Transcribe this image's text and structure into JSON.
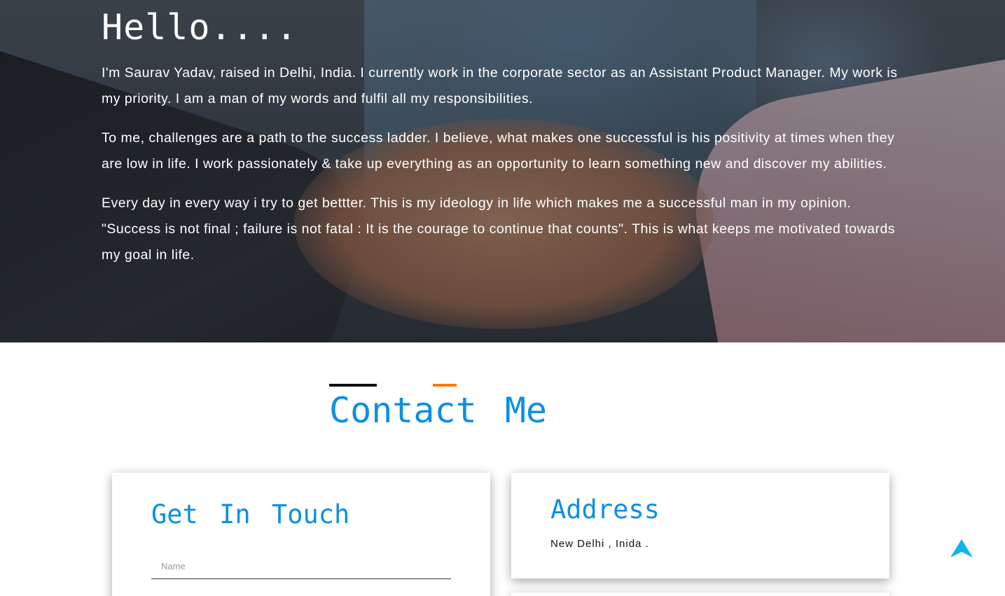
{
  "hero": {
    "greeting": "Hello....",
    "paragraphs": [
      "I'm Saurav Yadav, raised in Delhi, India. I currently work in the corporate sector as an Assistant Product Manager. My work is my priority. I am a man of my words and fulfil all my responsibilities.",
      "To me, challenges are a path to the success ladder. I believe, what makes one successful is his positivity at times when they are low in life. I work passionately & take up everything as an opportunity to learn something new and discover my abilities.",
      "Every day in every way i try to get bettter. This is my ideology in life which makes me a successful man in my opinion. \"Success is not final ; failure is not fatal : It is the courage to continue that counts\". This is what keeps me motivated towards my goal in life."
    ]
  },
  "contact": {
    "title": "Contact Me",
    "get_in_touch": {
      "heading": "Get In Touch",
      "name_placeholder": "Name"
    },
    "address": {
      "heading": "Address",
      "text": "New Delhi , Inida ."
    }
  },
  "colors": {
    "accent": "#0d90e0",
    "underline_orange": "#ff7a00",
    "scroll_top_arrow": "#13b3e6"
  },
  "icons": {
    "scroll_top": "arrow-up-icon"
  }
}
